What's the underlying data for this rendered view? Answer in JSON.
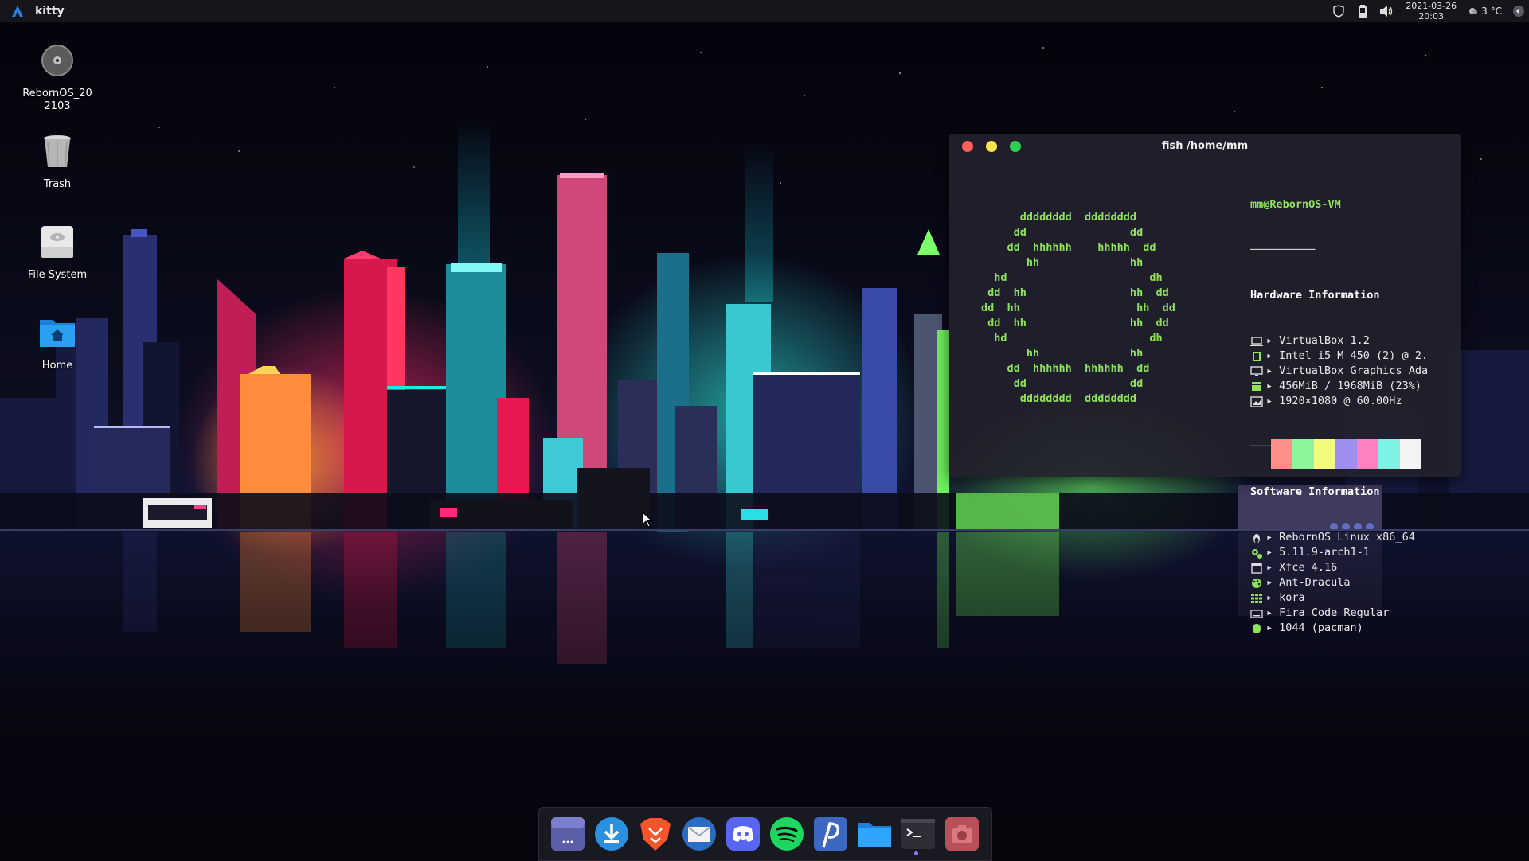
{
  "top_panel": {
    "app_title": "kitty",
    "clock_date": "2021-03-26",
    "clock_time": "20:03",
    "weather": "3 °C"
  },
  "desktop_icons": [
    {
      "label": "RebornOS_20\n2103",
      "icon": "optical-disc-icon"
    },
    {
      "label": "Trash",
      "icon": "trash-icon"
    },
    {
      "label": "File System",
      "icon": "drive-icon"
    },
    {
      "label": "Home",
      "icon": "home-folder-icon"
    }
  ],
  "terminal": {
    "title": "fish /home/mm",
    "ascii_logo": "      dddddddd  dddddddd\n     dd                dd\n    dd  hhhhhh    hhhhh  dd\n       hh              hh\n  hd                      dh\n dd  hh                hh  dd\ndd  hh                  hh  dd\n dd  hh                hh  dd\n  hd                      dh\n       hh              hh\n    dd  hhhhhh  hhhhhh  dd\n     dd                dd\n      dddddddd  dddddddd",
    "user_host": "mm@RebornOS-VM",
    "hardware_header": "Hardware Information",
    "hardware": [
      {
        "icon": "laptop-icon",
        "value": "VirtualBox 1.2"
      },
      {
        "icon": "cpu-icon",
        "value": "Intel i5 M 450 (2) @ 2."
      },
      {
        "icon": "monitor-icon",
        "value": "VirtualBox Graphics Ada"
      },
      {
        "icon": "memory-icon",
        "value": "456MiB / 1968MiB (23%)"
      },
      {
        "icon": "image-icon",
        "value": "1920×1080 @ 60.00Hz"
      }
    ],
    "software_header": "Software Information",
    "software": [
      {
        "icon": "tux-icon",
        "value": "RebornOS Linux x86_64"
      },
      {
        "icon": "gears-icon",
        "value": "5.11.9-arch1-1"
      },
      {
        "icon": "window-icon",
        "value": "Xfce 4.16"
      },
      {
        "icon": "palette-icon",
        "value": "Ant-Dracula"
      },
      {
        "icon": "grid-icon",
        "value": "kora"
      },
      {
        "icon": "keyboard-icon",
        "value": "Fira Code Regular"
      },
      {
        "icon": "package-icon",
        "value": "1044 (pacman)"
      }
    ],
    "arrow": "▸",
    "swatches": [
      "#ff8f88",
      "#8ff59a",
      "#f2fb7e",
      "#9c8ff0",
      "#ff80bf",
      "#7ef3e4",
      "#f4f4f4"
    ]
  },
  "dock": {
    "items": [
      {
        "name": "app-grid"
      },
      {
        "name": "downloader"
      },
      {
        "name": "brave-browser"
      },
      {
        "name": "mail-client"
      },
      {
        "name": "discord"
      },
      {
        "name": "spotify"
      },
      {
        "name": "pling-store"
      },
      {
        "name": "file-manager"
      },
      {
        "name": "terminal"
      },
      {
        "name": "screenshot"
      }
    ]
  }
}
